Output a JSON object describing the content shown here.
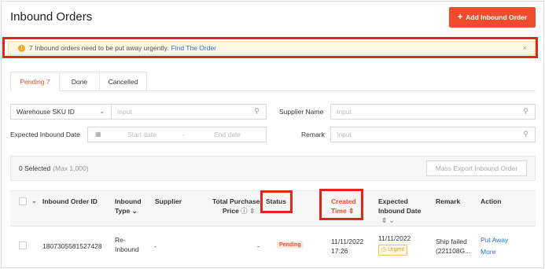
{
  "page": {
    "title": "Inbound Orders",
    "add_button": "Add Inbound Order"
  },
  "alert": {
    "text": "7 Inbound orders need to be put away urgently.",
    "link": "Find The Order",
    "close": "×"
  },
  "tabs": [
    {
      "label": "Pending 7"
    },
    {
      "label": "Done"
    },
    {
      "label": "Cancelled"
    }
  ],
  "filters": {
    "sku_select": "Warehouse SKU ID",
    "sku_placeholder": "Input",
    "supplier_label": "Supplier Name",
    "supplier_placeholder": "Input",
    "date_label": "Expected Inbound Date",
    "start_date": "Start date",
    "date_sep": "-",
    "end_date": "End date",
    "remark_label": "Remark",
    "remark_placeholder": "Input"
  },
  "selection": {
    "selected": "0 Selected",
    "max": "(Max 1,000)",
    "export_button": "Mass Export Inbound Order"
  },
  "table": {
    "headers": {
      "order_id": "Inbound Order ID",
      "type_1": "Inbound",
      "type_2": "Type",
      "supplier": "Supplier",
      "price_1": "Total Purchase",
      "price_2": "Price",
      "status": "Status",
      "created_1": "Created",
      "created_2": "Time",
      "expected_1": "Expected",
      "expected_2": "Inbound Date",
      "remark": "Remark",
      "action": "Action"
    },
    "rows": [
      {
        "order_id": "1807305581527428",
        "type_1": "Re-",
        "type_2": "Inbound",
        "supplier": "-",
        "price": "-",
        "status": "Pending",
        "created_date": "11/11/2022",
        "created_time": "17:26",
        "expected_date": "11/11/2022",
        "urgent": "Urgent",
        "remark_1": "Ship failed",
        "remark_2": "(221108G...",
        "action_1": "Put Away",
        "action_2": "More"
      }
    ]
  },
  "colors": {
    "accent": "#ee4d2d",
    "link": "#2673dd",
    "highlight": "#e5251b"
  }
}
